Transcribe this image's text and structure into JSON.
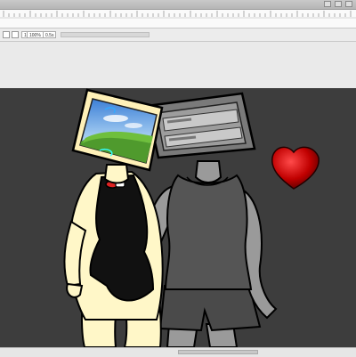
{
  "window": {
    "title": "",
    "controls": [
      "minimize-icon",
      "maximize-icon",
      "close-icon"
    ]
  },
  "toolbar": {
    "zoom_value": "100%",
    "frame_value": "0.5s",
    "layer_label": "1"
  },
  "stage": {
    "background": "#3d3d3d",
    "heart_color": "#cc0000",
    "tv_screen_scene": "green-hills-blue-sky"
  },
  "colors": {
    "canvas_bg": "#3d3d3d",
    "cream_body": "#fff7c8",
    "gray_body": "#9a9a9a",
    "dark_clothing": "#2a2a2a"
  }
}
